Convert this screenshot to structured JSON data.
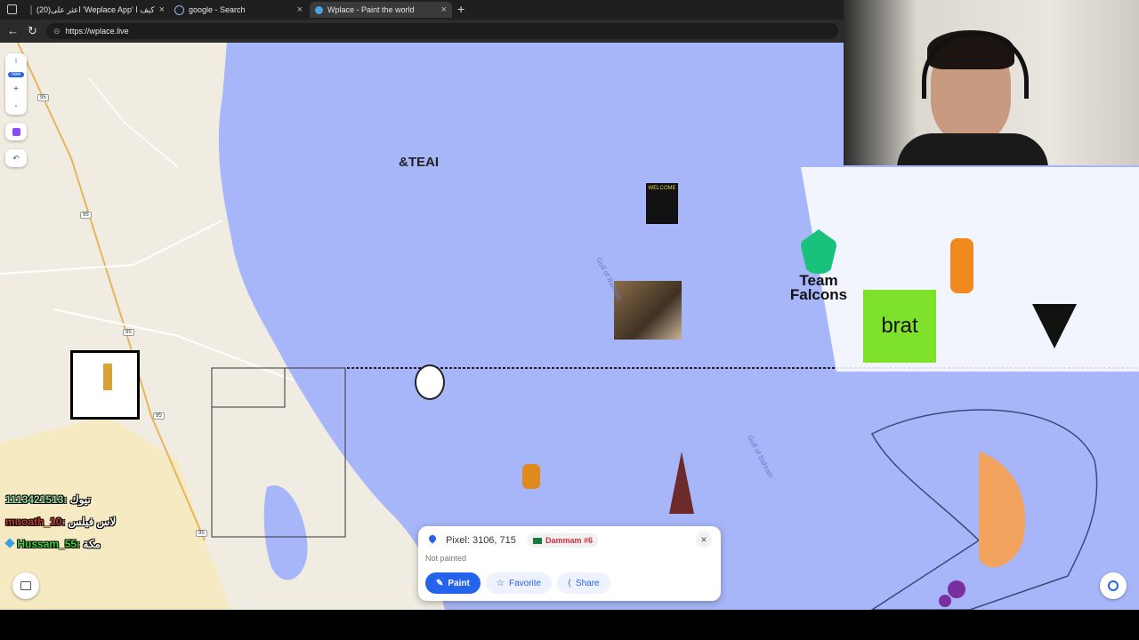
{
  "browser": {
    "tabs": [
      {
        "label": "(20)اعثر على 'Weplace App' كيف ا",
        "favicon": "tiktok-icon"
      },
      {
        "label": "google - Search",
        "favicon": "search-icon"
      },
      {
        "label": "Wplace - Paint the world",
        "favicon": "globe-icon"
      }
    ],
    "new_tab": "+",
    "url": "https://wplace.live"
  },
  "map": {
    "canvas_texts": {
      "team_tag": "&TEAI",
      "team_name_1": "Team",
      "team_name_2": "Falcons",
      "brat": "brat",
      "welcome": "WELCOME"
    },
    "water_labels": [
      "Gulf of Bahrain",
      "Gulf of Bahrain"
    ],
    "road_labels": [
      "95",
      "95",
      "95",
      "95",
      "95"
    ],
    "badge_new": "new"
  },
  "chat": [
    {
      "user": "1113421513:",
      "message": "تيوك",
      "color": "#8fd9a0"
    },
    {
      "user": "muoath_10:",
      "message": "لاس فيلس",
      "color": "#c0392b"
    },
    {
      "user": "Hussam_55:",
      "message": "مكة",
      "color": "#3ecf3e"
    }
  ],
  "popup": {
    "pixel_label": "Pixel: 3106, 715",
    "region": "Dammam #6",
    "status": "Not painted",
    "paint_label": "Paint",
    "favorite_label": "Favorite",
    "share_label": "Share",
    "close": "×"
  },
  "colors": {
    "water": "#a7b6f8",
    "land": "#f0ece2",
    "accent": "#2563eb",
    "region_red": "#d12c3c",
    "road": "#e7b55e"
  }
}
